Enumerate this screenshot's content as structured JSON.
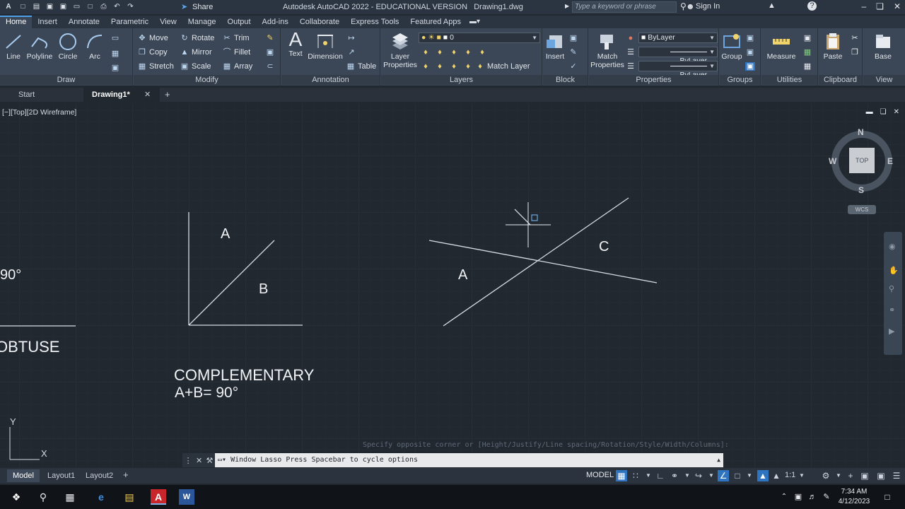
{
  "titlebar": {
    "app_title": "Autodesk AutoCAD 2022 - EDUCATIONAL VERSION",
    "file_name": "Drawing1.dwg",
    "share_label": "Share",
    "search_placeholder": "Type a keyword or phrase",
    "signin_label": "Sign In"
  },
  "menu_tabs": [
    "Home",
    "Insert",
    "Annotate",
    "Parametric",
    "View",
    "Manage",
    "Output",
    "Add-ins",
    "Collaborate",
    "Express Tools",
    "Featured Apps"
  ],
  "ribbon": {
    "draw": {
      "title": "Draw",
      "line": "Line",
      "polyline": "Polyline",
      "circle": "Circle",
      "arc": "Arc"
    },
    "modify": {
      "title": "Modify",
      "move": "Move",
      "rotate": "Rotate",
      "trim": "Trim",
      "copy": "Copy",
      "mirror": "Mirror",
      "fillet": "Fillet",
      "stretch": "Stretch",
      "scale": "Scale",
      "array": "Array"
    },
    "annotation": {
      "title": "Annotation",
      "text": "Text",
      "dimension": "Dimension",
      "table": "Table"
    },
    "layers": {
      "title": "Layers",
      "layer_properties_1": "Layer",
      "layer_properties_2": "Properties",
      "current_layer": "0",
      "match_layer": "Match Layer"
    },
    "block": {
      "title": "Block",
      "insert": "Insert"
    },
    "properties": {
      "title": "Properties",
      "match_1": "Match",
      "match_2": "Properties",
      "color": "ByLayer",
      "linetype": "ByLayer",
      "lineweight": "ByLayer"
    },
    "groups": {
      "title": "Groups",
      "group": "Group"
    },
    "utilities": {
      "title": "Utilities",
      "measure": "Measure"
    },
    "clipboard": {
      "title": "Clipboard",
      "paste": "Paste"
    },
    "view": {
      "title": "View",
      "base": "Base"
    }
  },
  "file_tabs": {
    "start": "Start",
    "drawing": "Drawing1*"
  },
  "canvas": {
    "viewport_label": "[−][Top][2D Wireframe]",
    "texts": {
      "a1": "A",
      "b1": "B",
      "ninety": "90°",
      "obtuse": "OBTUSE",
      "complementary": "COMPLEMENTARY",
      "formula": "A+B= 90°",
      "a2": "A",
      "c2": "C"
    },
    "viewcube": {
      "n": "N",
      "s": "S",
      "e": "E",
      "w": "W",
      "top": "TOP",
      "wcs": "WCS"
    },
    "ucs": {
      "x": "X",
      "y": "Y"
    }
  },
  "command": {
    "history": "Specify opposite corner or [Height/Justify/Line spacing/Rotation/Style/Width/Columns]:",
    "prompt": "Window Lasso  Press Spacebar to cycle options"
  },
  "layout_tabs": [
    "Model",
    "Layout1",
    "Layout2"
  ],
  "status": {
    "model": "MODEL",
    "scale": "1:1"
  },
  "taskbar": {
    "time": "7:34 AM",
    "date": "4/12/2023"
  },
  "colors": {
    "canvas_bg": "#212830",
    "ribbon_bg": "#3b4656",
    "accent": "#2f74c0",
    "autocad_red": "#e23b3b"
  }
}
